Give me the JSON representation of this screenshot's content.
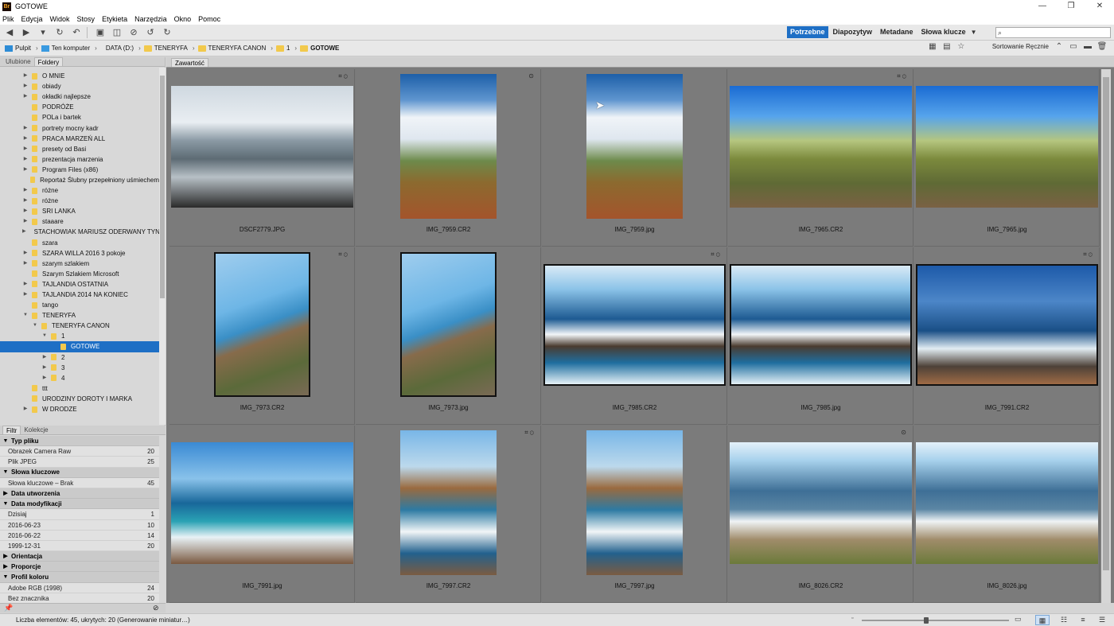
{
  "window": {
    "title": "GOTOWE",
    "app_icon": "Br",
    "controls": [
      "—",
      "❐",
      "✕"
    ]
  },
  "menu": [
    "Plik",
    "Edycja",
    "Widok",
    "Stosy",
    "Etykieta",
    "Narzędzia",
    "Okno",
    "Pomoc"
  ],
  "workspaces": {
    "items": [
      "Potrzebne",
      "Diapozytyw",
      "Metadane",
      "Słowa klucze"
    ],
    "active": "Potrzebne"
  },
  "search": {
    "placeholder": "",
    "icon": "search-icon"
  },
  "path": [
    {
      "label": "Pulpit",
      "icon": "desk"
    },
    {
      "label": "Ten komputer",
      "icon": "pc"
    },
    {
      "label": "DATA (D:)",
      "icon": "drive"
    },
    {
      "label": "TENERYFA",
      "icon": "folder"
    },
    {
      "label": "TENERYFA CANON",
      "icon": "folder"
    },
    {
      "label": "1",
      "icon": "folder"
    },
    {
      "label": "GOTOWE",
      "icon": "folder"
    }
  ],
  "sort": {
    "label": "Sortowanie Ręcznie"
  },
  "left_tabs": {
    "favorites": "Ulubione",
    "folders": "Foldery"
  },
  "folder_tree": [
    {
      "label": "O MNIE",
      "level": 0,
      "expander": "▶"
    },
    {
      "label": "obiady",
      "level": 0,
      "expander": "▶"
    },
    {
      "label": "okładki najlepsze",
      "level": 0,
      "expander": "▶"
    },
    {
      "label": "PODRÓŻE",
      "level": 0,
      "expander": ""
    },
    {
      "label": "POLa i bartek",
      "level": 0,
      "expander": ""
    },
    {
      "label": "portrety mocny kadr",
      "level": 0,
      "expander": "▶"
    },
    {
      "label": "PRACA MARZEŃ ALL",
      "level": 0,
      "expander": "▶"
    },
    {
      "label": "presety od Basi",
      "level": 0,
      "expander": "▶"
    },
    {
      "label": "prezentacja marzenia",
      "level": 0,
      "expander": "▶"
    },
    {
      "label": "Program Files (x86)",
      "level": 0,
      "expander": "▶"
    },
    {
      "label": "Reportaż Ślubny przepełniony uśmiechem",
      "level": 0,
      "expander": ""
    },
    {
      "label": "różne",
      "level": 0,
      "expander": "▶"
    },
    {
      "label": "różne",
      "level": 0,
      "expander": "▶"
    },
    {
      "label": "SRI LANKA",
      "level": 0,
      "expander": "▶"
    },
    {
      "label": "staaare",
      "level": 0,
      "expander": "▶"
    },
    {
      "label": "STACHOWIAK MARIUSZ ODERWANY TYN",
      "level": 0,
      "expander": "▶"
    },
    {
      "label": "szara",
      "level": 0,
      "expander": ""
    },
    {
      "label": "SZARA WILLA 2016 3 pokoje",
      "level": 0,
      "expander": "▶"
    },
    {
      "label": "szarym szlakiem",
      "level": 0,
      "expander": "▶"
    },
    {
      "label": "Szarym Szlakiem Microsoft",
      "level": 0,
      "expander": ""
    },
    {
      "label": "TAJLANDIA OSTATNIA",
      "level": 0,
      "expander": "▶"
    },
    {
      "label": "TAJLANDIA 2014 NA KONIEC",
      "level": 0,
      "expander": "▶"
    },
    {
      "label": "tango",
      "level": 0,
      "expander": ""
    },
    {
      "label": "TENERYFA",
      "level": 0,
      "expander": "▼"
    },
    {
      "label": "TENERYFA CANON",
      "level": 1,
      "expander": "▼"
    },
    {
      "label": "1",
      "level": 2,
      "expander": "▼"
    },
    {
      "label": "GOTOWE",
      "level": 3,
      "expander": "",
      "selected": true
    },
    {
      "label": "2",
      "level": 2,
      "expander": "▶"
    },
    {
      "label": "3",
      "level": 2,
      "expander": "▶"
    },
    {
      "label": "4",
      "level": 2,
      "expander": "▶"
    },
    {
      "label": "ttt",
      "level": 0,
      "expander": ""
    },
    {
      "label": "URODZINY DOROTY I MARKA",
      "level": 0,
      "expander": ""
    },
    {
      "label": "W DRODZE",
      "level": 0,
      "expander": "▶"
    }
  ],
  "filter_tabs": {
    "filter": "Filtr",
    "collections": "Kolekcje"
  },
  "filter": [
    {
      "header": "Typ pliku",
      "open": true,
      "items": [
        {
          "label": "Obrazek Camera Raw",
          "count": "20"
        },
        {
          "label": "Plik JPEG",
          "count": "25"
        }
      ]
    },
    {
      "header": "Słowa kluczowe",
      "open": true,
      "items": [
        {
          "label": "Słowa kluczowe – Brak",
          "count": "45"
        }
      ]
    },
    {
      "header": "Data utworzenia",
      "open": false,
      "items": []
    },
    {
      "header": "Data modyfikacji",
      "open": true,
      "items": [
        {
          "label": "Dzisiaj",
          "count": "1"
        },
        {
          "label": "2016-06-23",
          "count": "10"
        },
        {
          "label": "2016-06-22",
          "count": "14"
        },
        {
          "label": "1999-12-31",
          "count": "20"
        }
      ]
    },
    {
      "header": "Orientacja",
      "open": false,
      "items": []
    },
    {
      "header": "Proporcje",
      "open": false,
      "items": []
    },
    {
      "header": "Profil koloru",
      "open": true,
      "items": [
        {
          "label": "Adobe RGB (1998)",
          "count": "24"
        },
        {
          "label": "Bez znacznika",
          "count": "20"
        }
      ]
    }
  ],
  "content_tab": "Zawartość",
  "thumbnails": [
    {
      "name": "DSCF2779.JPG",
      "style": "img-sea-bw",
      "orient": "h",
      "badge": "⌗⊙"
    },
    {
      "name": "IMG_7959.CR2",
      "style": "img-cactus",
      "orient": "v",
      "badge": "⊙"
    },
    {
      "name": "IMG_7959.jpg",
      "style": "img-cactus",
      "orient": "v",
      "badge": ""
    },
    {
      "name": "IMG_7965.CR2",
      "style": "img-valley",
      "orient": "h",
      "badge": "⌗⊙"
    },
    {
      "name": "IMG_7965.jpg",
      "style": "img-valley",
      "orient": "h",
      "badge": ""
    },
    {
      "name": "IMG_7973.CR2",
      "style": "img-cliff-v",
      "orient": "v",
      "badge": "⌗⊙",
      "framed": true
    },
    {
      "name": "IMG_7973.jpg",
      "style": "img-cliff-v",
      "orient": "v",
      "badge": "",
      "framed": true
    },
    {
      "name": "IMG_7985.CR2",
      "style": "img-wave",
      "orient": "h",
      "badge": "⌗⊙",
      "framed": true
    },
    {
      "name": "IMG_7985.jpg",
      "style": "img-wave",
      "orient": "h",
      "badge": "",
      "framed": true
    },
    {
      "name": "IMG_7991.CR2",
      "style": "img-coast",
      "orient": "h",
      "badge": "⌗⊙",
      "framed": true
    },
    {
      "name": "IMG_7991.jpg",
      "style": "img-beach",
      "orient": "h",
      "badge": ""
    },
    {
      "name": "IMG_7997.CR2",
      "style": "img-beach-v",
      "orient": "v",
      "badge": "⌗⊙"
    },
    {
      "name": "IMG_7997.jpg",
      "style": "img-beach-v",
      "orient": "v",
      "badge": ""
    },
    {
      "name": "IMG_8026.CR2",
      "style": "img-mountain",
      "orient": "h",
      "badge": "⊙"
    },
    {
      "name": "IMG_8026.jpg",
      "style": "img-mountain",
      "orient": "h",
      "badge": ""
    }
  ],
  "status": {
    "text": "Liczba elementów: 45, ukrytych: 20 (Generowanie miniatur…)",
    "zoom_fraction": 0.42
  },
  "colors": {
    "accent": "#1e6fc5",
    "content_bg": "#7a7a7a",
    "folder": "#f2c94c"
  }
}
